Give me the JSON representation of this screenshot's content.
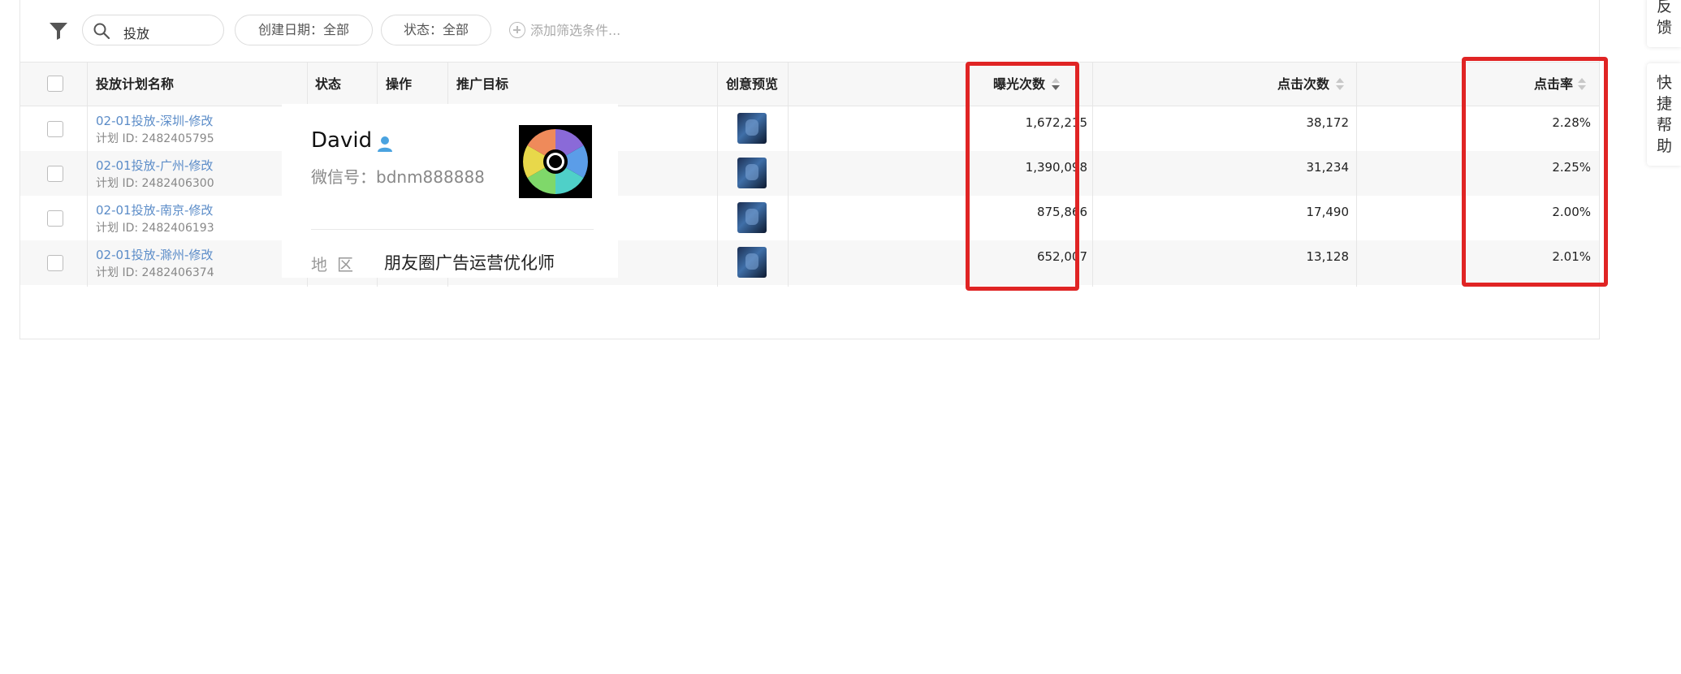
{
  "filter_bar": {
    "search_value": "投放",
    "date_filter": "创建日期：全部",
    "status_filter": "状态：全部",
    "add_filter": "添加筛选条件..."
  },
  "table": {
    "headers": {
      "plan_name": "投放计划名称",
      "status": "状态",
      "action": "操作",
      "target": "推广目标",
      "creative": "创意预览",
      "impressions": "曝光次数",
      "clicks": "点击次数",
      "ctr": "点击率"
    },
    "rows": [
      {
        "name": "02-01投放-深圳-修改",
        "plan_id": "计划 ID: 2482405795",
        "impressions": "1,672,215",
        "clicks": "38,172",
        "ctr": "2.28%"
      },
      {
        "name": "02-01投放-广州-修改",
        "plan_id": "计划 ID: 2482406300",
        "impressions": "1,390,098",
        "clicks": "31,234",
        "ctr": "2.25%"
      },
      {
        "name": "02-01投放-南京-修改",
        "plan_id": "计划 ID: 2482406193",
        "impressions": "875,866",
        "clicks": "17,490",
        "ctr": "2.00%"
      },
      {
        "name": "02-01投放-滁州-修改",
        "plan_id": "计划 ID: 2482406374",
        "impressions": "652,007",
        "clicks": "13,128",
        "ctr": "2.01%"
      }
    ]
  },
  "card": {
    "name": "David",
    "wechat": "微信号：bdnm888888",
    "region_label": "地区",
    "region_value": "朋友圈广告运营优化师"
  },
  "side_tabs": {
    "feedback": [
      "反",
      "馈"
    ],
    "quick_help": [
      "快",
      "捷",
      "帮",
      "助"
    ]
  },
  "colors": {
    "link": "#5b8cc8",
    "highlight": "#e02424",
    "header_bg": "#f7f7f7"
  },
  "icons": [
    "filter-icon",
    "search-icon",
    "add-circle-icon",
    "sort-icon",
    "person-icon",
    "camera-aperture-logo"
  ]
}
